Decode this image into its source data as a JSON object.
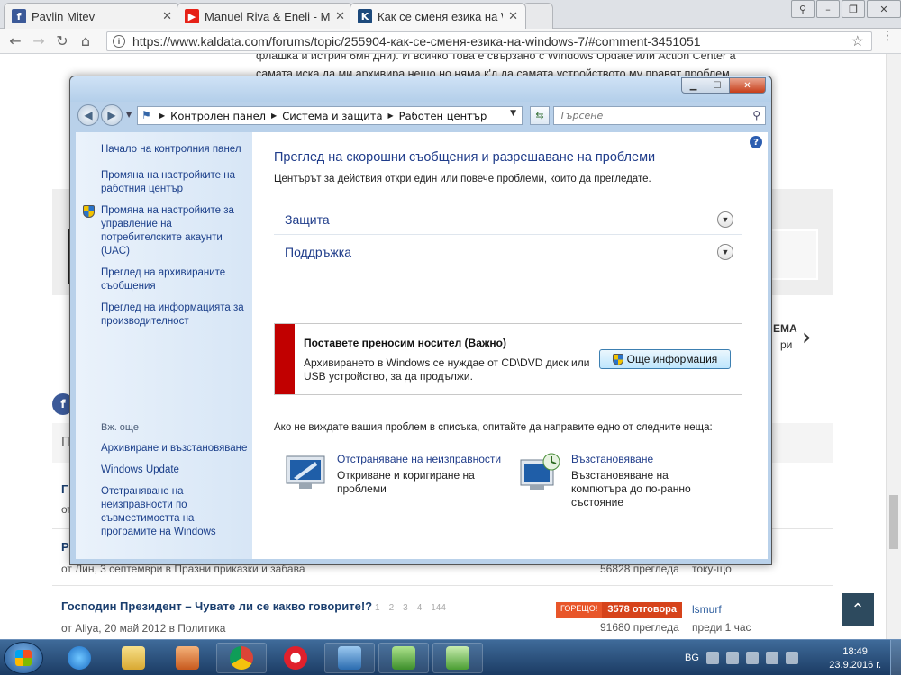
{
  "browser": {
    "tabs": [
      {
        "title": "Pavlin Mitev",
        "favicon": "facebook-icon",
        "color": "#3b5998"
      },
      {
        "title": "Manuel Riva & Eneli - MI",
        "favicon": "youtube-icon",
        "color": "#e62117"
      },
      {
        "title": "Как се сменя езика на W",
        "favicon": "kaldata-icon",
        "color": "#1d4a7c"
      }
    ],
    "url": "https://www.kaldata.com/forums/topic/255904-как-се-сменя-езика-на-windows-7/#comment-3451051"
  },
  "background_page": {
    "text_line_1": "флашка и истрия 6мн дни). И всичко това е свързано с Windows Update или Action Center а",
    "text_line_2": "самата иска да ми архивира нещо но няма к'д да самата устройството му правят проблем.",
    "right_label_1": "ЕМА",
    "right_label_2": "ри",
    "forum_items": [
      {
        "title_initial": "Г",
        "meta_initial": "от"
      },
      {
        "title_initial": "Р",
        "meta_author": "от Лин, 3 септември в Празни приказки и забава",
        "views": "56828 прегледа",
        "last": "току-що"
      },
      {
        "title": "Господин Президент – Чувате ли се какво говорите!?",
        "pages": [
          "1",
          "2",
          "3",
          "4",
          "144"
        ],
        "meta_author": "от Aliya, 20 май 2012 в Политика",
        "badge": "ГОРЕЩО!",
        "replies": "3578 отговора",
        "views": "91680 прегледа",
        "last_user": "lsmurf",
        "last": "преди 1 час"
      }
    ],
    "section_letter": "П"
  },
  "window": {
    "breadcrumbs": [
      "Контролен панел",
      "Система и защита",
      "Работен център"
    ],
    "search_placeholder": "Търсене",
    "left_links": [
      {
        "label": "Начало на контролния панел",
        "shield": false
      },
      {
        "label": "Промяна на настройките на работния център",
        "shield": false
      },
      {
        "label": "Промяна на настройките за управление на потребителските акаунти (UAC)",
        "shield": true
      },
      {
        "label": "Преглед на архивираните съобщения",
        "shield": false
      },
      {
        "label": "Преглед на информацията за производителност",
        "shield": false
      }
    ],
    "see_also": "Вж. още",
    "see_also_links": [
      "Архивиране и възстановяване",
      "Windows Update",
      "Отстраняване на неизправности по съвместимостта на програмите на Windows"
    ],
    "heading": "Преглед на скорошни съобщения и разрешаване на проблеми",
    "subheading": "Центърът за действия откри един или повече проблеми, които да прегледате.",
    "sections": [
      "Защита",
      "Поддръжка"
    ],
    "alert": {
      "title": "Поставете преносим носител (Важно)",
      "desc": "Архивирането в Windows се нуждае от CD\\DVD диск или USB устройство, за да продължи.",
      "button": "Още информация",
      "color": "#c10000"
    },
    "prompt": "Ако не виждате вашия проблем в списъка, опитайте да направите едно от следните неща:",
    "tools": [
      {
        "link": "Отстраняване на неизправности",
        "desc": "Откриване и коригиране на проблеми",
        "icon": "troubleshoot-icon"
      },
      {
        "link": "Възстановяване",
        "desc": "Възстановяване на компютъра до по-ранно състояние",
        "icon": "recovery-icon"
      }
    ]
  },
  "taskbar": {
    "lang": "BG",
    "time": "18:49",
    "date": "23.9.2016 г."
  }
}
